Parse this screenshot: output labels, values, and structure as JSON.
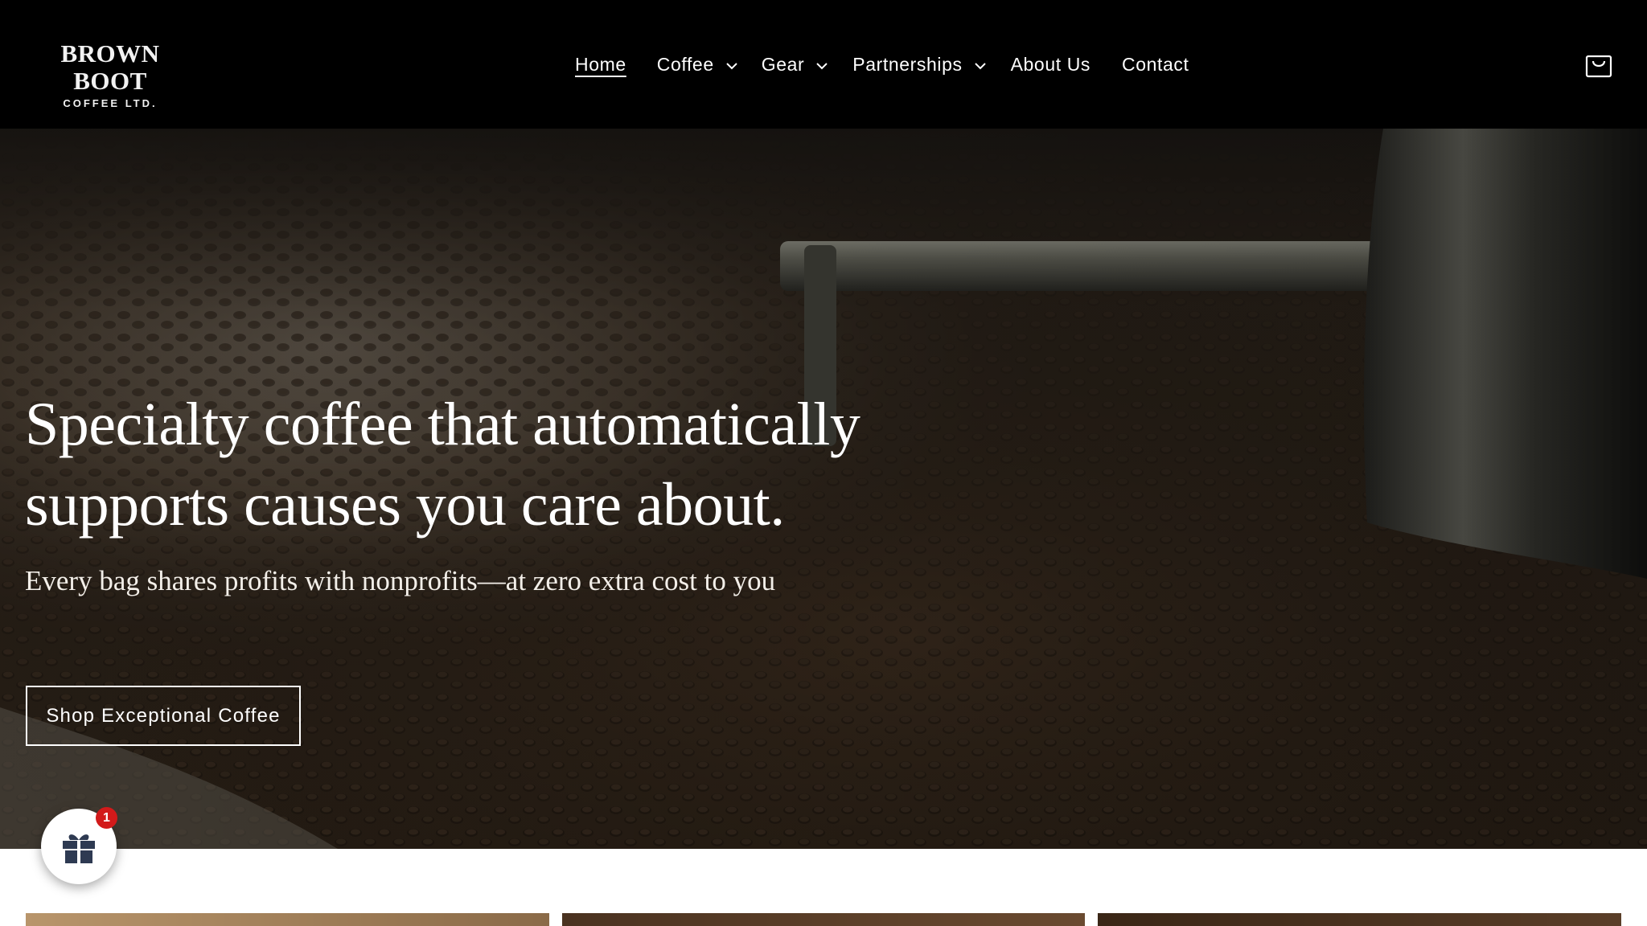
{
  "brand": {
    "name": "BROWN BOOT",
    "subname": "COFFEE LTD."
  },
  "nav": {
    "items": [
      {
        "label": "Home",
        "active": true,
        "dropdown": false
      },
      {
        "label": "Coffee",
        "active": false,
        "dropdown": true
      },
      {
        "label": "Gear",
        "active": false,
        "dropdown": true
      },
      {
        "label": "Partnerships",
        "active": false,
        "dropdown": true
      },
      {
        "label": "About Us",
        "active": false,
        "dropdown": false
      },
      {
        "label": "Contact",
        "active": false,
        "dropdown": false
      }
    ],
    "cart_icon": "shopping-bag-icon"
  },
  "hero": {
    "title_line1": "Specialty coffee that automatically",
    "title_line2": "supports causes you care about.",
    "subtitle": "Every bag shares profits with nonprofits—at zero extra cost to you",
    "cta_label": "Shop Exceptional Coffee",
    "background": "coffee beans in a roaster drum"
  },
  "gift_widget": {
    "icon": "gift-icon",
    "badge_count": "1"
  },
  "colors": {
    "header_bg": "#000000",
    "text_light": "#ffffff",
    "badge_red": "#d21a1a"
  }
}
